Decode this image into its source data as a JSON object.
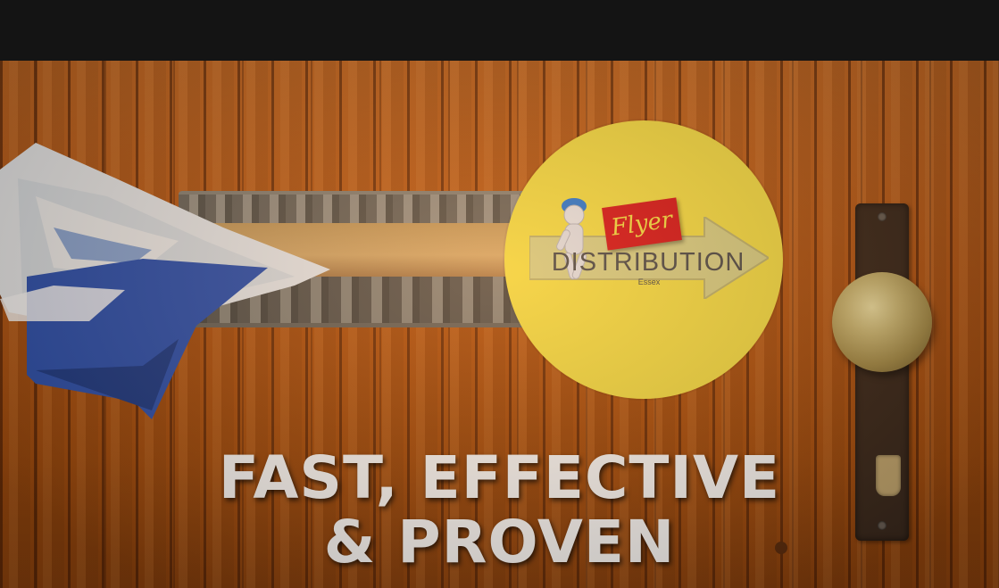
{
  "logo": {
    "tag": "Flyer",
    "word": "DISTRIBUTION",
    "sub": "Essex",
    "colors": {
      "circle": "#f6e14a",
      "tag": "#d7191f",
      "text": "#4f4f4f"
    }
  },
  "headline": {
    "line1": "FAST, EFFECTIVE",
    "line2": "& PROVEN"
  },
  "colors": {
    "topbar": "#141414",
    "wood": "#b95a17"
  }
}
